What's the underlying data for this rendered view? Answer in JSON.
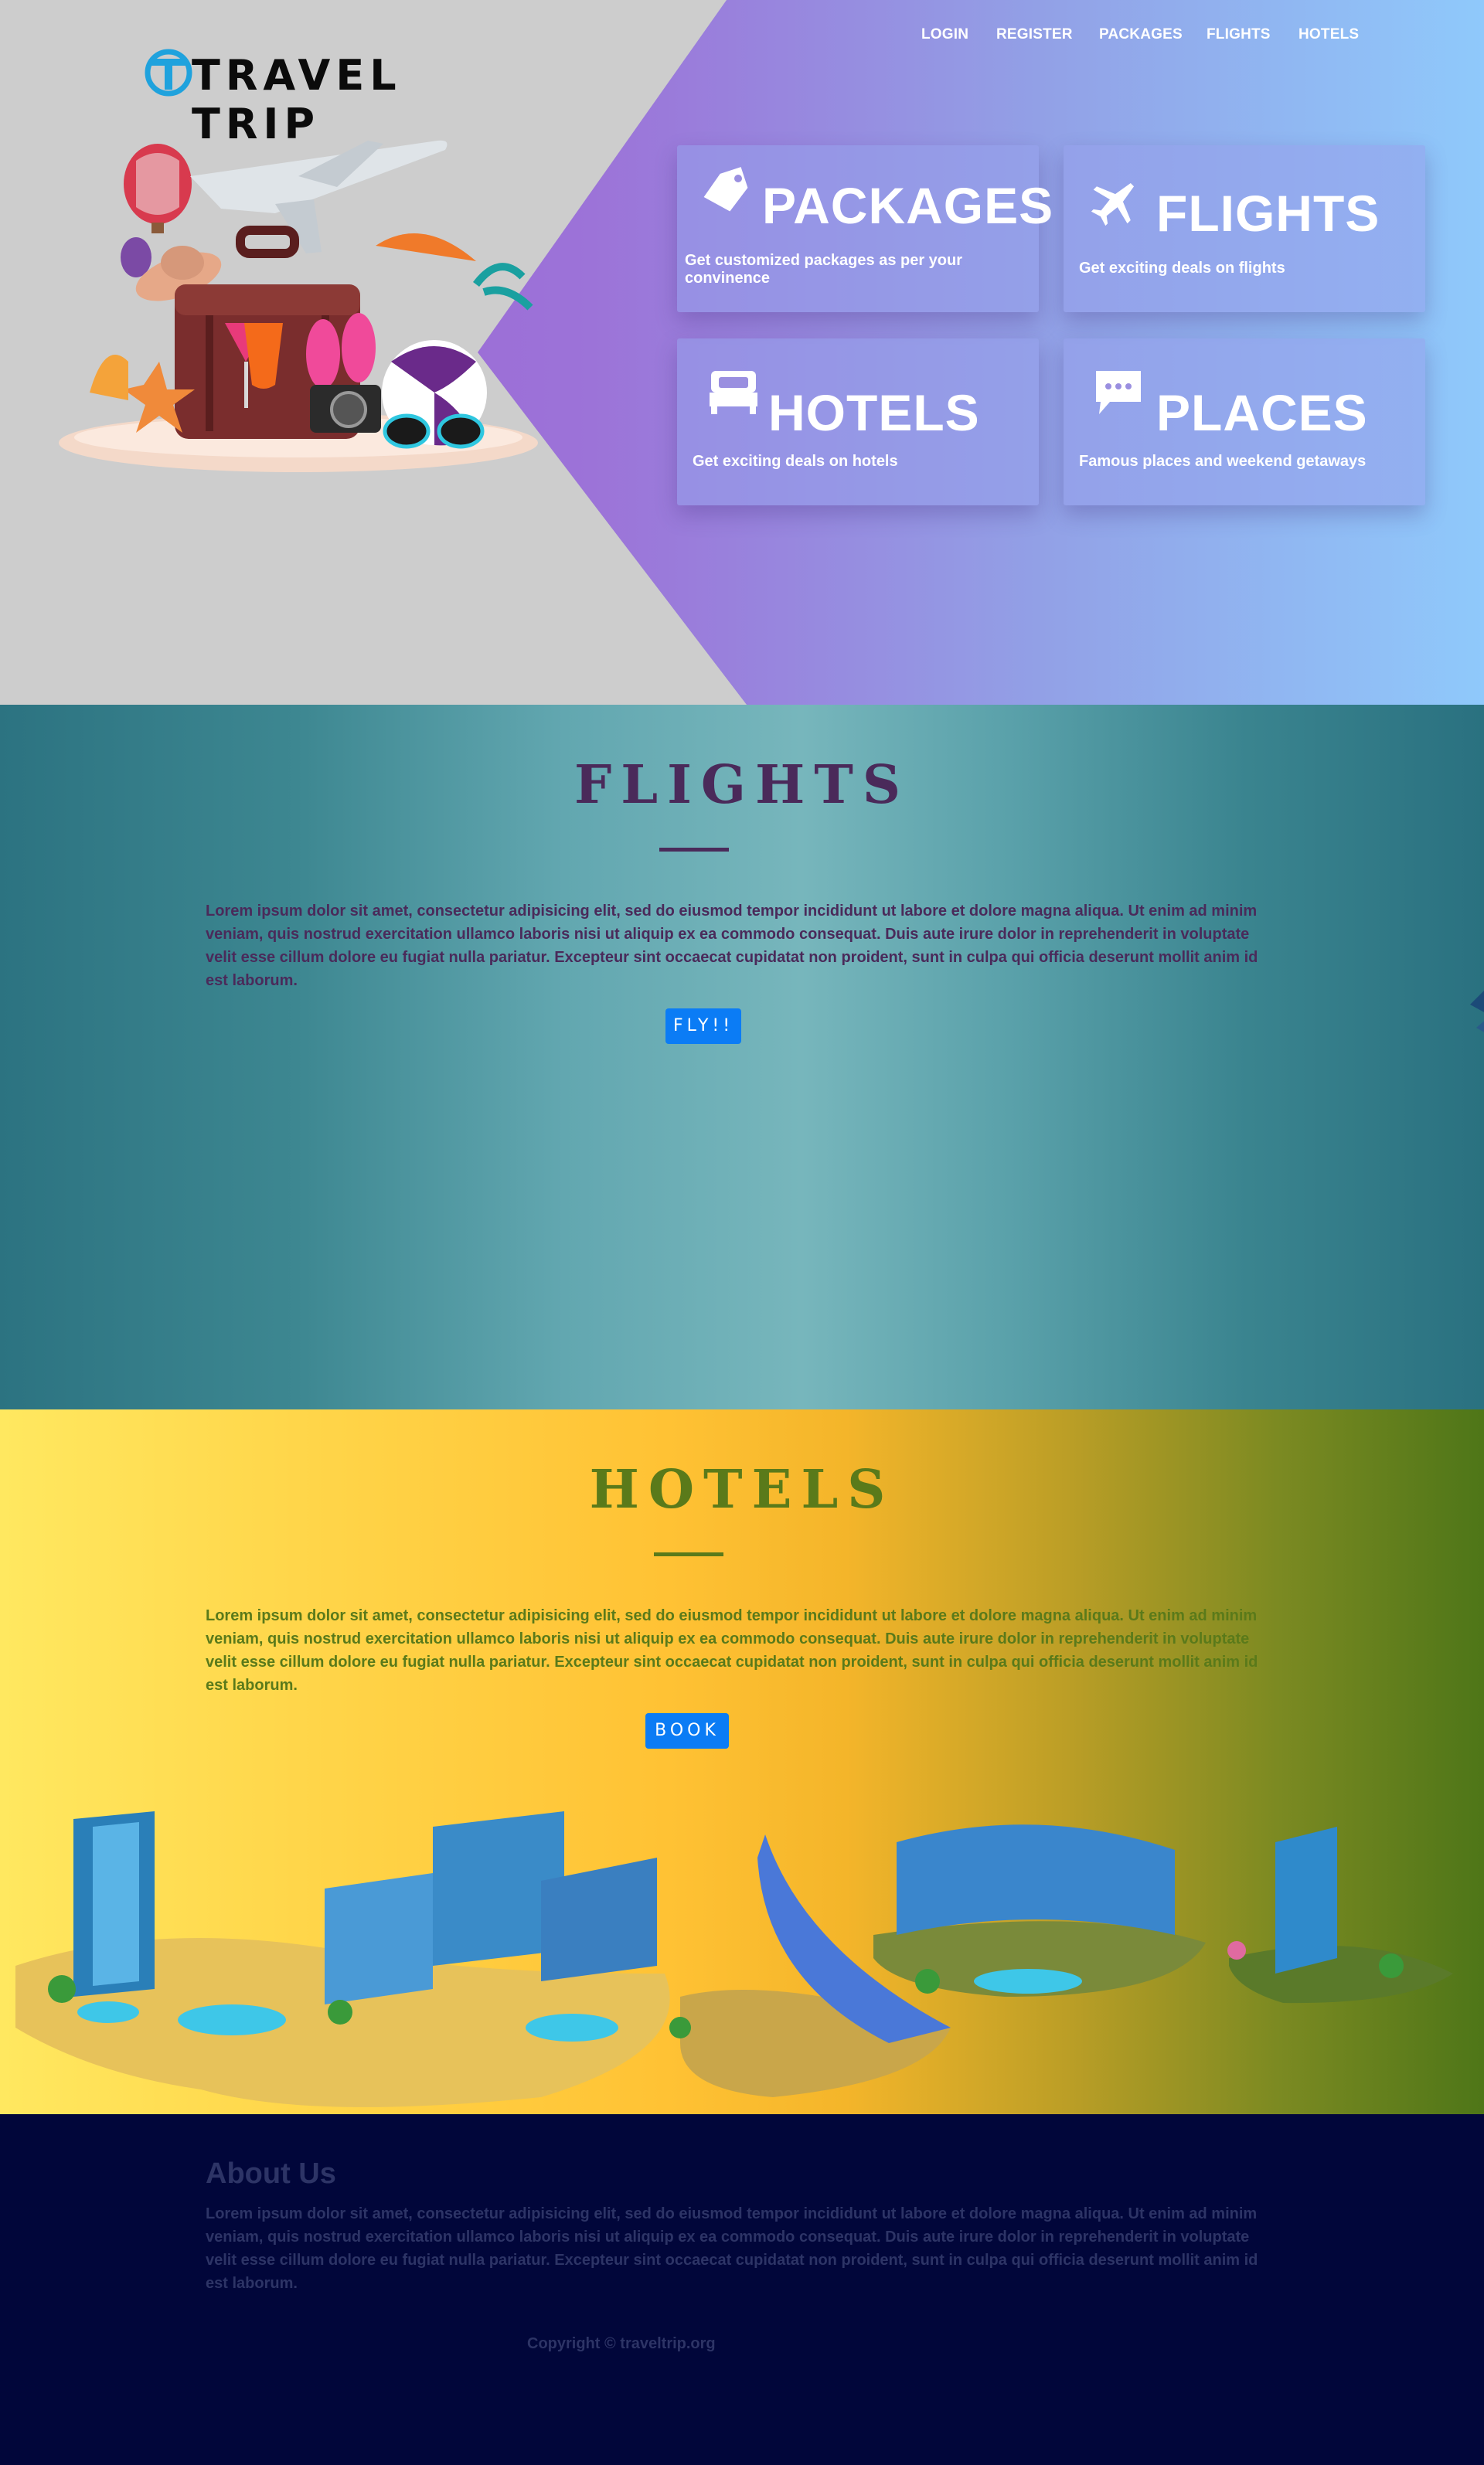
{
  "nav": {
    "items": [
      "LOGIN",
      "REGISTER",
      "PACKAGES",
      "FLIGHTS",
      "HOTELS"
    ]
  },
  "logo": {
    "text": "TRAVEL TRIP",
    "mark_letter": "T"
  },
  "hero": {
    "illustration": "travel-suitcase-beach-illustration",
    "cards": [
      {
        "icon": "tag-icon",
        "title": "PACKAGES",
        "desc": "Get customized packages as per your convinence"
      },
      {
        "icon": "airplane-icon",
        "title": "FLIGHTS",
        "desc": "Get exciting deals on flights"
      },
      {
        "icon": "bed-icon",
        "title": "HOTELS",
        "desc": "Get exciting deals on hotels"
      },
      {
        "icon": "chat-icon",
        "title": "PLACES",
        "desc": "Famous places and weekend getaways"
      }
    ]
  },
  "flights": {
    "title": "FLIGHTS",
    "body": "Lorem ipsum dolor sit amet, consectetur adipisicing elit, sed do eiusmod tempor incididunt ut labore et dolore magna aliqua. Ut enim ad minim veniam, quis nostrud exercitation ullamco laboris nisi ut aliquip ex ea commodo consequat. Duis aute irure dolor in reprehenderit in voluptate velit esse cillum dolore eu fugiat nulla pariatur. Excepteur sint occaecat cupidatat non proident, sunt in culpa qui officia deserunt mollit anim id est laborum.",
    "button": "FLY!!",
    "title_color": "#4a2a5a"
  },
  "hotels": {
    "title": "HOTELS",
    "body": "Lorem ipsum dolor sit amet, consectetur adipisicing elit, sed do eiusmod tempor incididunt ut labore et dolore magna aliqua. Ut enim ad minim veniam, quis nostrud exercitation ullamco laboris nisi ut aliquip ex ea commodo consequat. Duis aute irure dolor in reprehenderit in voluptate velit esse cillum dolore eu fugiat nulla pariatur. Excepteur sint occaecat cupidatat non proident, sunt in culpa qui officia deserunt mollit anim id est laborum.",
    "button": "BOOK",
    "title_color": "#5a7a1a",
    "illustration": "resort-islands-illustration"
  },
  "footer": {
    "about_title": "About Us",
    "about_body": "Lorem ipsum dolor sit amet, consectetur adipisicing elit, sed do eiusmod tempor incididunt ut labore et dolore magna aliqua. Ut enim ad minim veniam, quis nostrud exercitation ullamco laboris nisi ut aliquip ex ea commodo consequat. Duis aute irure dolor in reprehenderit in voluptate velit esse cillum dolore eu fugiat nulla pariatur. Excepteur sint occaecat cupidatat non proident, sunt in culpa qui officia deserunt mollit anim id est laborum.",
    "copyright": "Copyright © traveltrip.org"
  },
  "colors": {
    "button_blue": "#0b7cf5",
    "footer_bg": "#01063a",
    "footer_text": "#2d3466"
  }
}
